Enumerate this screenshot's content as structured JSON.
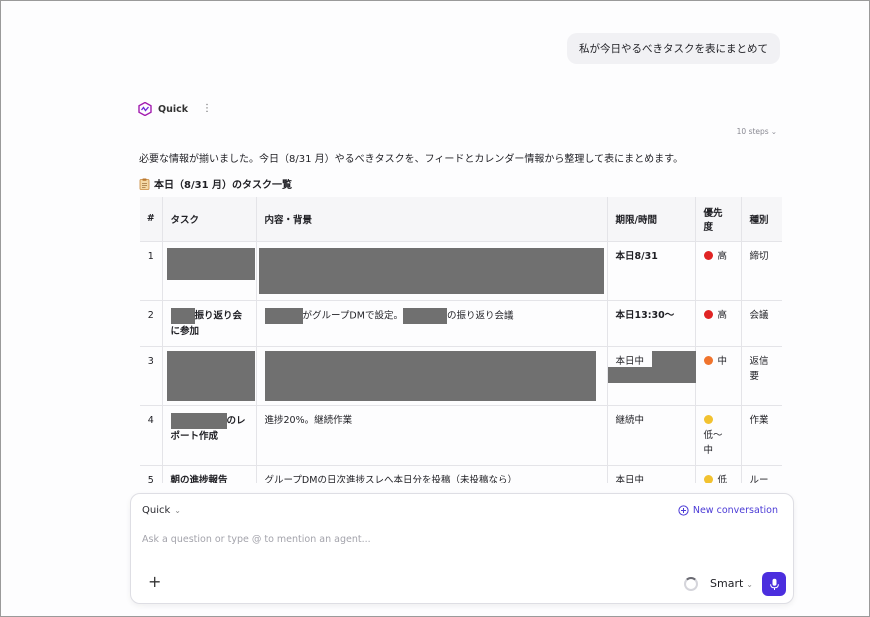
{
  "conversation": {
    "user_message": "私が今日やるべきタスクを表にまとめて",
    "agent_name": "Quick",
    "steps_label": "10 steps",
    "intro_text": "必要な情報が揃いました。今日（8/31 月）やるべきタスクを、フィードとカレンダー情報から整理して表にまとめます。",
    "table_title": "本日（8/31 月）のタスク一覧",
    "table_title_icon": "clipboard-icon"
  },
  "table": {
    "headers": {
      "num": "#",
      "task": "タスク",
      "detail": "内容・背景",
      "due": "期限/時間",
      "priority_line1": "優先",
      "priority_line2": "度",
      "type": "種別"
    },
    "rows": [
      {
        "num": "1",
        "task": "",
        "detail": "",
        "due": "本日8/31",
        "priority": "高",
        "priority_color": "#e02424",
        "type": "締切"
      },
      {
        "num": "2",
        "task_a": "振り返り会",
        "task_b": "に参加",
        "detail_a": "がグループDMで設定。",
        "detail_b": "の振り返り会議",
        "due": "本日13:30〜",
        "priority": "高",
        "priority_color": "#e02424",
        "type": "会議"
      },
      {
        "num": "3",
        "task": "",
        "detail": "",
        "due": "本日中",
        "priority": "中",
        "priority_color": "#f0742d",
        "type_a": "返信",
        "type_b": "要"
      },
      {
        "num": "4",
        "task_a": "のレ",
        "task_b": "ポート作成",
        "detail": "進捗20%。継続作業",
        "due": "継続中",
        "priority_a": "低〜",
        "priority_b": "中",
        "priority_color": "#f2c230",
        "type": "作業"
      },
      {
        "num": "5",
        "task": "朝の進捗報告",
        "detail": "グループDMの日次進捗スレへ本日分を投稿（未投稿なら）",
        "due": "本日中",
        "priority": "低",
        "priority_color": "#f2c230",
        "type": "ルー"
      }
    ]
  },
  "composer": {
    "agent_select": "Quick",
    "new_conversation": "New conversation",
    "placeholder": "Ask a question or type @ to mention an agent...",
    "mode": "Smart",
    "accent_color": "#4b2ede"
  }
}
